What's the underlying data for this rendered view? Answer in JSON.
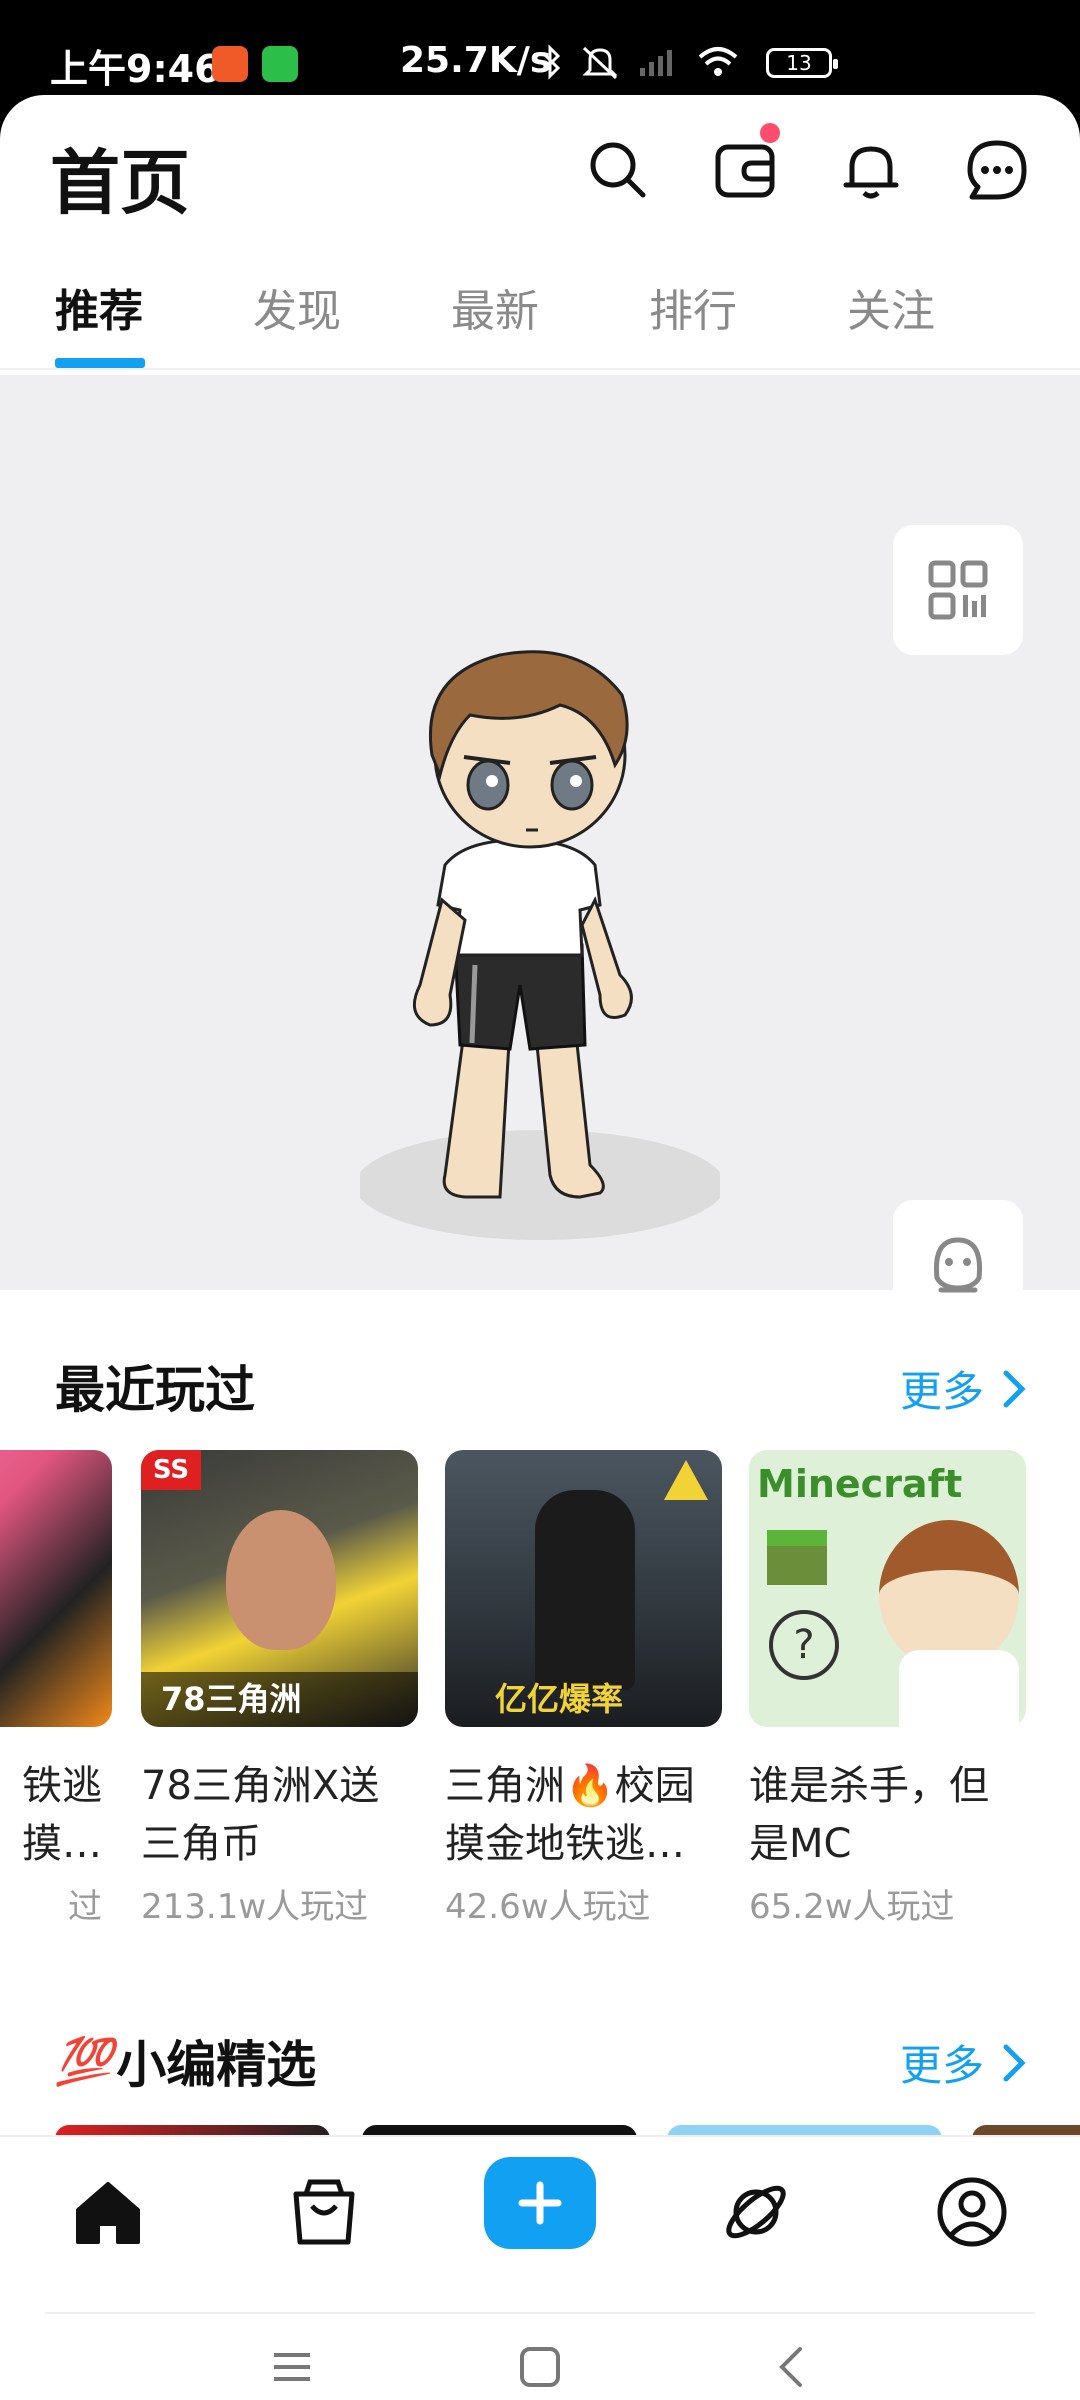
{
  "status_bar": {
    "time": "上午9:46",
    "network_speed": "25.7K/s",
    "battery": "13"
  },
  "header": {
    "title": "首页",
    "icons": [
      "search-icon",
      "wallet-icon",
      "bell-icon",
      "chat-icon"
    ]
  },
  "tabs": [
    {
      "label": "推荐",
      "active": true
    },
    {
      "label": "发现",
      "active": false
    },
    {
      "label": "最新",
      "active": false
    },
    {
      "label": "排行",
      "active": false
    },
    {
      "label": "关注",
      "active": false
    }
  ],
  "recent": {
    "title": "最近玩过",
    "more": "更多",
    "items": [
      {
        "title": "铁逃\n摸…",
        "players": "过"
      },
      {
        "title": "78三角洲X送三角币",
        "players": "213.1w人玩过",
        "thumb_text": "78三角洲"
      },
      {
        "title": "三角洲🔥校园摸金地铁逃…",
        "players": "42.6w人玩过",
        "thumb_text": "亿亿爆率"
      },
      {
        "title": "谁是杀手，但是MC",
        "players": "65.2w人玩过",
        "thumb_text": "Minecraft"
      }
    ]
  },
  "editor_pick": {
    "title": "小编精选",
    "emoji": "💯",
    "more": "更多"
  },
  "colors": {
    "accent": "#12a0f2"
  }
}
